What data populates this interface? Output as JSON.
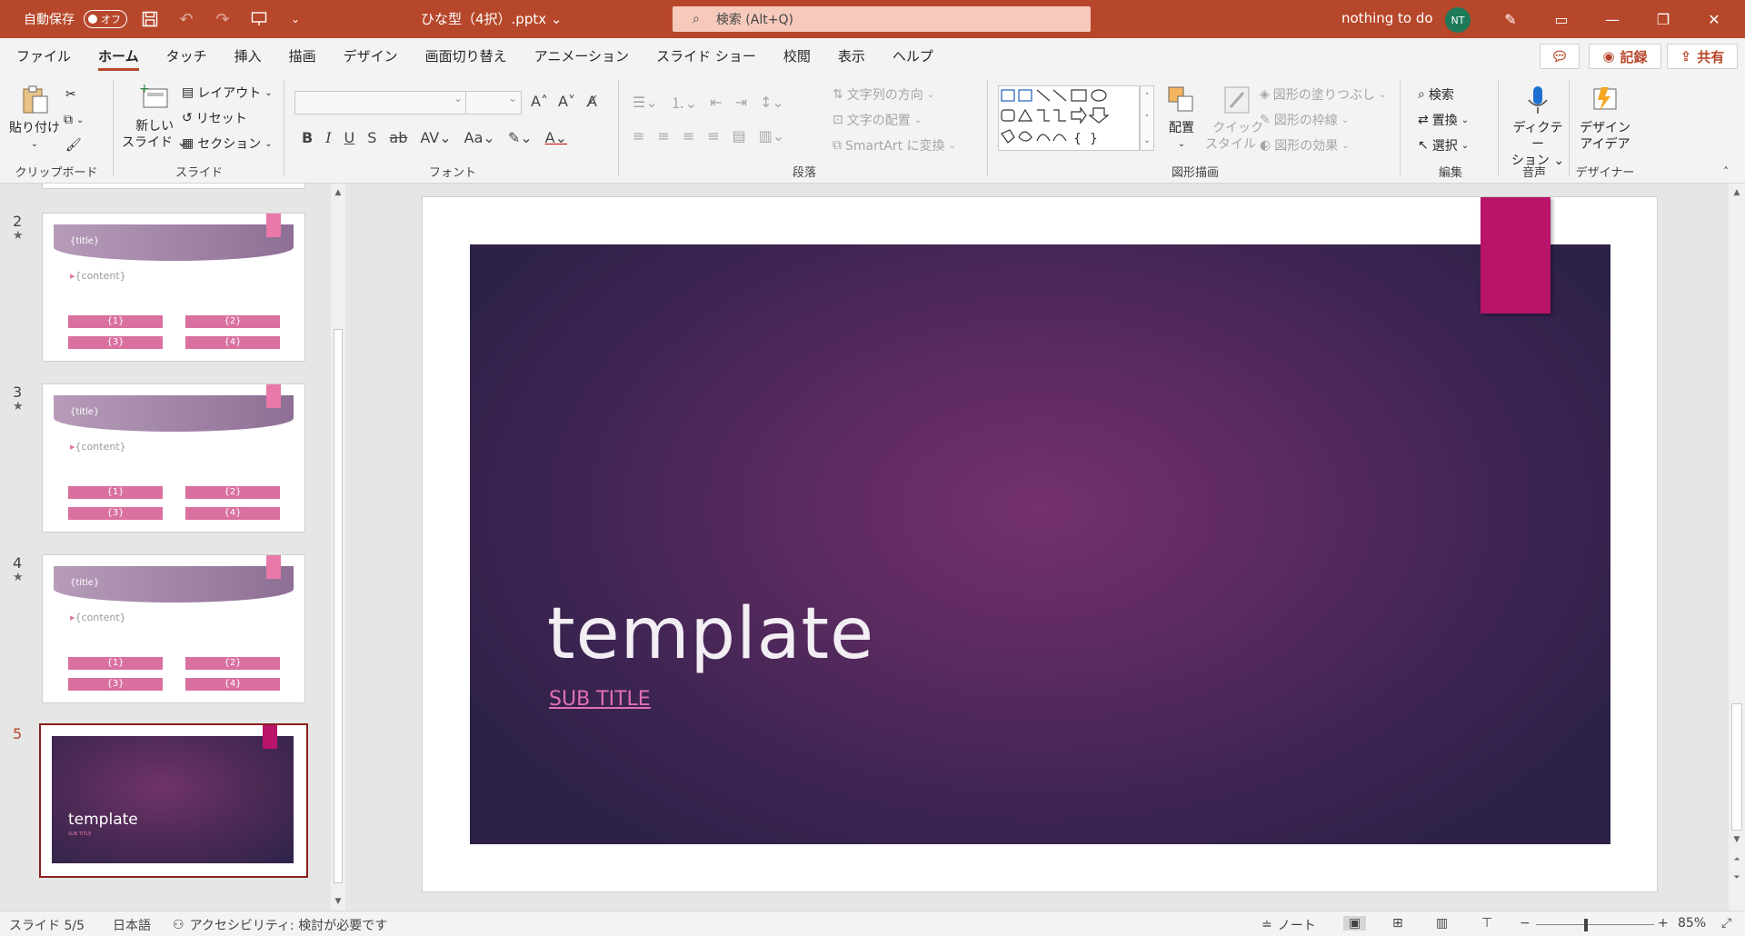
{
  "titlebar": {
    "autosave_label": "自動保存",
    "autosave_state": "オフ",
    "doc_title": "ひな型（4択）.pptx",
    "search_placeholder": "検索 (Alt+Q)",
    "user_name": "nothing to do",
    "user_initials": "NT"
  },
  "tabs": [
    "ファイル",
    "ホーム",
    "タッチ",
    "挿入",
    "描画",
    "デザイン",
    "画面切り替え",
    "アニメーション",
    "スライド ショー",
    "校閲",
    "表示",
    "ヘルプ"
  ],
  "active_tab": "ホーム",
  "header_actions": {
    "record": "記録",
    "share": "共有"
  },
  "ribbon": {
    "clipboard": {
      "paste": "貼り付け",
      "label": "クリップボード"
    },
    "slides": {
      "new_slide_line1": "新しい",
      "new_slide_line2": "スライド",
      "layout": "レイアウト",
      "reset": "リセット",
      "section": "セクション",
      "label": "スライド"
    },
    "font": {
      "label": "フォント"
    },
    "paragraph": {
      "text_direction": "文字列の方向",
      "align_text": "文字の配置",
      "smartart": "SmartArt に変換",
      "label": "段落"
    },
    "drawing": {
      "arrange": "配置",
      "quick_style_line1": "クイック",
      "quick_style_line2": "スタイル",
      "fill": "図形の塗りつぶし",
      "outline": "図形の枠線",
      "effect": "図形の効果",
      "label": "図形描画"
    },
    "editing": {
      "find": "検索",
      "replace": "置換",
      "select": "選択",
      "label": "編集"
    },
    "voice": {
      "dictate_line1": "ディクテー",
      "dictate_line2": "ション",
      "label": "音声"
    },
    "designer": {
      "idea_line1": "デザイン",
      "idea_line2": "アイデア",
      "label": "デザイナー"
    }
  },
  "thumbnails": [
    {
      "number": "2",
      "title": "{title}",
      "content": "{content}",
      "pills": [
        "{1}",
        "{2}",
        "{3}",
        "{4}"
      ]
    },
    {
      "number": "3",
      "title": "{title}",
      "content": "{content}",
      "pills": [
        "{1}",
        "{2}",
        "{3}",
        "{4}"
      ]
    },
    {
      "number": "4",
      "title": "{title}",
      "content": "{content}",
      "pills": [
        "{1}",
        "{2}",
        "{3}",
        "{4}"
      ]
    }
  ],
  "selected_thumb": {
    "number": "5",
    "title": "template",
    "subtitle": "SUB TITLE"
  },
  "slide": {
    "title": "template",
    "subtitle": "SUB TITLE"
  },
  "status": {
    "slide_info": "スライド 5/5",
    "language": "日本語",
    "accessibility": "アクセシビリティ: 検討が必要です",
    "notes": "ノート",
    "zoom": "85%"
  },
  "colors": {
    "accent": "#b7472a",
    "bookmark": "#b8146a",
    "subtitle": "#e070b4"
  }
}
